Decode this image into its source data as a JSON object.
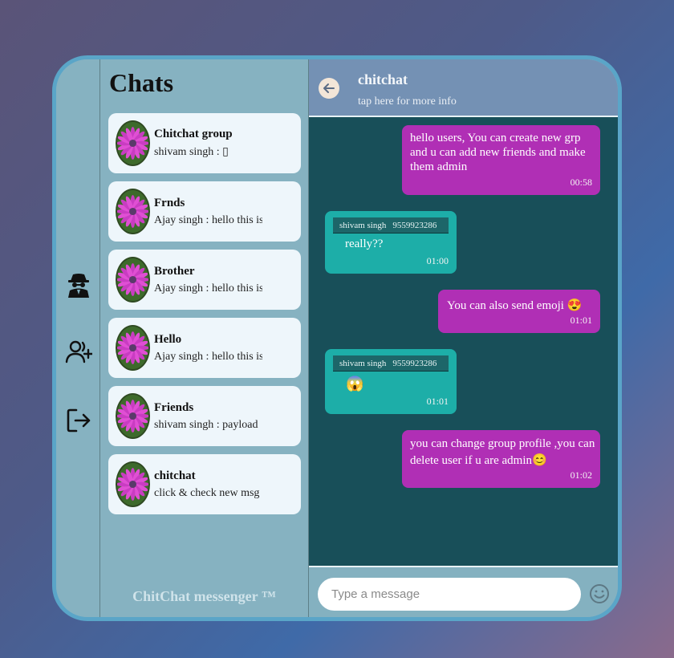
{
  "app": {
    "brand": "ChitChat messenger ™"
  },
  "colors": {
    "frame_border": "#5aa5c8",
    "panel_bg": "#86b2c1",
    "header_bg": "#7491b4",
    "messages_bg": "#184f59",
    "outgoing_bubble": "#b02fb5",
    "incoming_bubble": "#1daea8",
    "card_bg": "#eef6fb"
  },
  "sidebar": {
    "icons": [
      "incognito-user-icon",
      "add-user-icon",
      "logout-icon"
    ]
  },
  "chat_list": {
    "title": "Chats",
    "items": [
      {
        "name": "Chitchat group",
        "last": "shivam singh : ▯"
      },
      {
        "name": "Frnds",
        "last": "Ajay singh : hello this is"
      },
      {
        "name": "Brother",
        "last": "Ajay singh : hello this is"
      },
      {
        "name": "Hello",
        "last": "Ajay singh : hello this is"
      },
      {
        "name": "Friends",
        "last": "shivam singh : payload"
      },
      {
        "name": "chitchat",
        "last": "click & check new msg"
      }
    ]
  },
  "chat": {
    "title": "chitchat",
    "subtitle": "tap here for more info",
    "messages": [
      {
        "direction": "out",
        "text": "hello users, You can create new grp and u can add new friends and make them admin",
        "time": "00:58"
      },
      {
        "direction": "in",
        "sender": "shivam singh",
        "phone": "9559923286",
        "text": "really??",
        "time": "01:00"
      },
      {
        "direction": "out",
        "text": "You can also send emoji 😍",
        "time": "01:01"
      },
      {
        "direction": "in",
        "sender": "shivam singh",
        "phone": "9559923286",
        "text": "😱",
        "time": "01:01"
      },
      {
        "direction": "out",
        "text": "you can change group profile ,you can delete user if u are admin😊",
        "time": "01:02"
      }
    ]
  },
  "composer": {
    "placeholder": "Type a message",
    "value": ""
  }
}
